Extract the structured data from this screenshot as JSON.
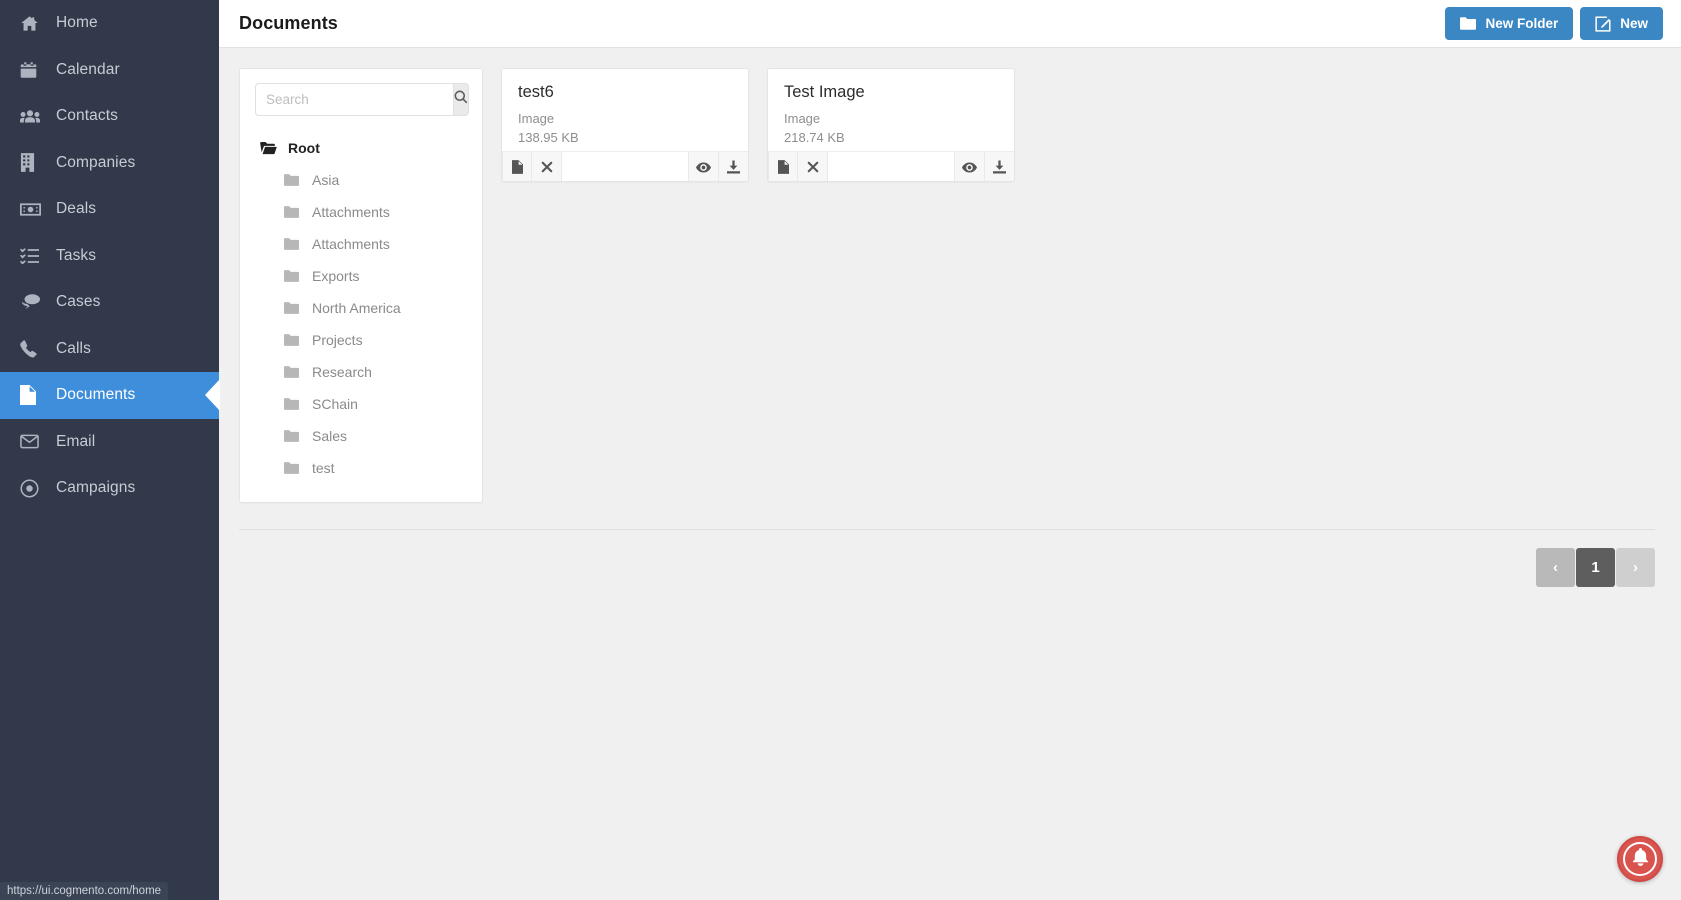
{
  "sidebar": {
    "items": [
      {
        "label": "Home",
        "icon": "home-icon",
        "active": false
      },
      {
        "label": "Calendar",
        "icon": "calendar-icon",
        "active": false
      },
      {
        "label": "Contacts",
        "icon": "contacts-icon",
        "active": false
      },
      {
        "label": "Companies",
        "icon": "building-icon",
        "active": false
      },
      {
        "label": "Deals",
        "icon": "money-icon",
        "active": false
      },
      {
        "label": "Tasks",
        "icon": "tasks-list-icon",
        "active": false
      },
      {
        "label": "Cases",
        "icon": "chat-bubbles-icon",
        "active": false
      },
      {
        "label": "Calls",
        "icon": "phone-icon",
        "active": false
      },
      {
        "label": "Documents",
        "icon": "document-icon",
        "active": true
      },
      {
        "label": "Email",
        "icon": "envelope-icon",
        "active": false
      },
      {
        "label": "Campaigns",
        "icon": "target-icon",
        "active": false
      }
    ]
  },
  "header": {
    "title": "Documents",
    "new_folder_label": "New Folder",
    "new_label": "New",
    "accent_color": "#3b87c4"
  },
  "tree_panel": {
    "search": {
      "value": "",
      "placeholder": "Search"
    },
    "root": {
      "label": "Root",
      "icon": "open-folder-icon"
    },
    "folders": [
      {
        "label": "Asia"
      },
      {
        "label": "Attachments"
      },
      {
        "label": "Attachments"
      },
      {
        "label": "Exports"
      },
      {
        "label": "North America"
      },
      {
        "label": "Projects"
      },
      {
        "label": "Research"
      },
      {
        "label": "SChain"
      },
      {
        "label": "Sales"
      },
      {
        "label": "test"
      }
    ]
  },
  "documents": [
    {
      "name": "test6",
      "type": "Image",
      "size": "138.95 KB"
    },
    {
      "name": "Test Image",
      "type": "Image",
      "size": "218.74 KB"
    }
  ],
  "pagination": {
    "prev_label": "‹",
    "next_label": "›",
    "current_page": "1"
  },
  "statusbar": {
    "url": "https://ui.cogmento.com/home"
  },
  "notification": {
    "icon": "bell-icon",
    "color": "#d9534f"
  }
}
